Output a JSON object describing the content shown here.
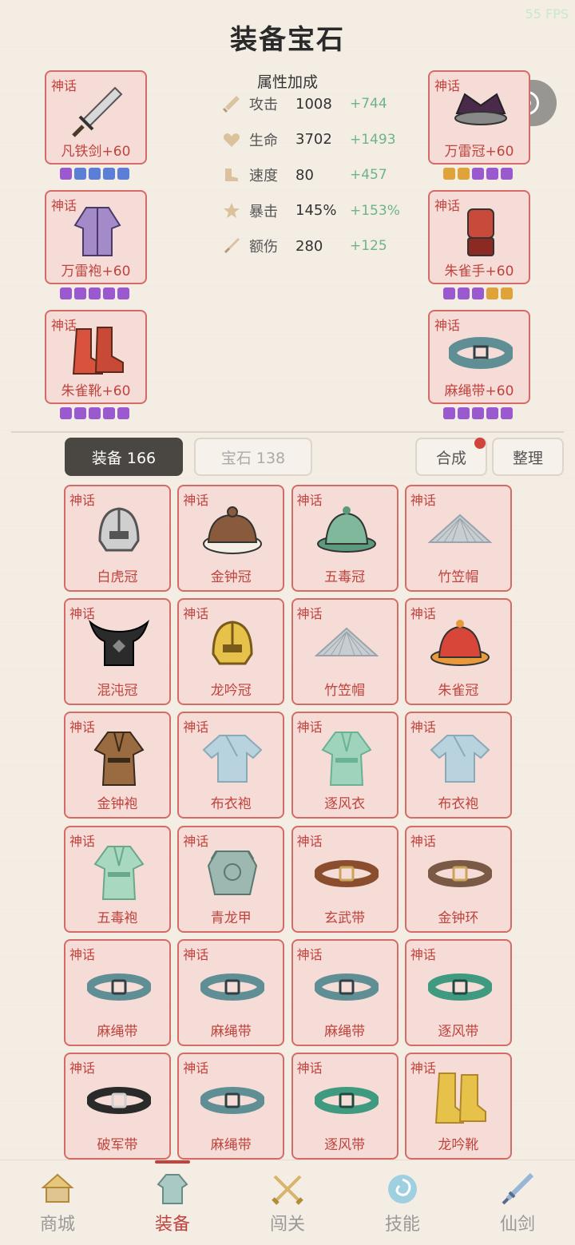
{
  "status": {
    "fps": "55 FPS"
  },
  "title": "装备宝石",
  "capsule": {
    "more_icon": "more-dots-icon",
    "close_icon": "target-icon"
  },
  "equipped": [
    {
      "tier": "神话",
      "name": "凡铁剑+60",
      "icon": "sword-icon",
      "gems": [
        "#9b59d0",
        "#5b7fd6",
        "#5b7fd6",
        "#5b7fd6",
        "#5b7fd6"
      ]
    },
    {
      "tier": "神话",
      "name": "万雷冠+60",
      "icon": "crown-icon",
      "gems": [
        "#e0a33a",
        "#e0a33a",
        "#9b59d0",
        "#9b59d0",
        "#9b59d0"
      ]
    },
    {
      "tier": "神话",
      "name": "万雷袍+60",
      "icon": "robe-icon",
      "gems": [
        "#9b59d0",
        "#9b59d0",
        "#9b59d0",
        "#9b59d0",
        "#9b59d0"
      ]
    },
    {
      "tier": "神话",
      "name": "朱雀手+60",
      "icon": "glove-icon",
      "gems": [
        "#9b59d0",
        "#9b59d0",
        "#9b59d0",
        "#e0a33a",
        "#e0a33a"
      ]
    },
    {
      "tier": "神话",
      "name": "朱雀靴+60",
      "icon": "boots-icon",
      "gems": [
        "#9b59d0",
        "#9b59d0",
        "#9b59d0",
        "#9b59d0",
        "#9b59d0"
      ]
    },
    {
      "tier": "神话",
      "name": "麻绳带+60",
      "icon": "belt-icon",
      "gems": [
        "#9b59d0",
        "#9b59d0",
        "#9b59d0",
        "#9b59d0",
        "#9b59d0"
      ]
    }
  ],
  "attributes": {
    "heading": "属性加成",
    "rows": [
      {
        "icon": "sword-attr-icon",
        "label": "攻击",
        "value": "1008",
        "bonus": "+744"
      },
      {
        "icon": "heart-icon",
        "label": "生命",
        "value": "3702",
        "bonus": "+1493"
      },
      {
        "icon": "boot-attr-icon",
        "label": "速度",
        "value": "80",
        "bonus": "+457"
      },
      {
        "icon": "star-icon",
        "label": "暴击",
        "value": "145%",
        "bonus": "+153%"
      },
      {
        "icon": "dagger-attr-icon",
        "label": "额伤",
        "value": "280",
        "bonus": "+125"
      }
    ]
  },
  "tabs": {
    "equip": "装备 166",
    "gem": "宝石 138",
    "synth": "合成",
    "sort": "整理"
  },
  "inventory": [
    {
      "tier": "神话",
      "name": "白虎冠",
      "kind": "helmet",
      "color": "#cfcfcf",
      "accent": "#555555"
    },
    {
      "tier": "神话",
      "name": "金钟冠",
      "kind": "cap",
      "color": "#8a5a3c",
      "accent": "#f4eee4"
    },
    {
      "tier": "神话",
      "name": "五毒冠",
      "kind": "bell-hat",
      "color": "#7fb89b",
      "accent": "#5b9a7c"
    },
    {
      "tier": "神话",
      "name": "竹笠帽",
      "kind": "straw-hat",
      "color": "#c8cdd2",
      "accent": "#9aa3ab"
    },
    {
      "tier": "神话",
      "name": "混沌冠",
      "kind": "horn-helmet",
      "color": "#2b2b2b",
      "accent": "#888888"
    },
    {
      "tier": "神话",
      "name": "龙吟冠",
      "kind": "helmet",
      "color": "#e7c24a",
      "accent": "#7a5a1a"
    },
    {
      "tier": "神话",
      "name": "竹笠帽",
      "kind": "straw-hat",
      "color": "#c8cdd2",
      "accent": "#9aa3ab"
    },
    {
      "tier": "神话",
      "name": "朱雀冠",
      "kind": "bell-hat",
      "color": "#d8463a",
      "accent": "#e89a3a"
    },
    {
      "tier": "神话",
      "name": "金钟袍",
      "kind": "robe",
      "color": "#9a6a40",
      "accent": "#3a2a1a"
    },
    {
      "tier": "神话",
      "name": "布衣袍",
      "kind": "shirt",
      "color": "#b9d3de",
      "accent": "#8aaab8"
    },
    {
      "tier": "神话",
      "name": "逐风衣",
      "kind": "robe",
      "color": "#9fd3bc",
      "accent": "#6ab294"
    },
    {
      "tier": "神话",
      "name": "布衣袍",
      "kind": "shirt",
      "color": "#b9d3de",
      "accent": "#8aaab8"
    },
    {
      "tier": "神话",
      "name": "五毒袍",
      "kind": "robe",
      "color": "#a8d8bf",
      "accent": "#6aa88a"
    },
    {
      "tier": "神话",
      "name": "青龙甲",
      "kind": "armor",
      "color": "#9cb8b0",
      "accent": "#5a7870"
    },
    {
      "tier": "神话",
      "name": "玄武带",
      "kind": "belt",
      "color": "#8a4e2e",
      "accent": "#c9a45a"
    },
    {
      "tier": "神话",
      "name": "金钟环",
      "kind": "belt",
      "color": "#7a5a44",
      "accent": "#c9a45a"
    },
    {
      "tier": "神话",
      "name": "麻绳带",
      "kind": "belt",
      "color": "#5f8f95",
      "accent": "#2f3f44"
    },
    {
      "tier": "神话",
      "name": "麻绳带",
      "kind": "belt",
      "color": "#5f8f95",
      "accent": "#2f3f44"
    },
    {
      "tier": "神话",
      "name": "麻绳带",
      "kind": "belt",
      "color": "#5f8f95",
      "accent": "#2f3f44"
    },
    {
      "tier": "神话",
      "name": "逐风带",
      "kind": "belt",
      "color": "#3f9a80",
      "accent": "#1f4a3f"
    },
    {
      "tier": "神话",
      "name": "破军带",
      "kind": "belt",
      "color": "#2a2a2a",
      "accent": "#cfcfcf"
    },
    {
      "tier": "神话",
      "name": "麻绳带",
      "kind": "belt",
      "color": "#5f8f95",
      "accent": "#2f3f44"
    },
    {
      "tier": "神话",
      "name": "逐风带",
      "kind": "belt",
      "color": "#3f9a80",
      "accent": "#1f4a3f"
    },
    {
      "tier": "神话",
      "name": "龙吟靴",
      "kind": "tall-boots",
      "color": "#e7c24a",
      "accent": "#b3862a"
    }
  ],
  "nav": [
    {
      "label": "商城",
      "icon": "shop-icon",
      "active": false
    },
    {
      "label": "装备",
      "icon": "equipment-icon",
      "active": true
    },
    {
      "label": "闯关",
      "icon": "crossed-swords-icon",
      "active": false
    },
    {
      "label": "技能",
      "icon": "swirl-icon",
      "active": false
    },
    {
      "label": "仙剑",
      "icon": "flying-sword-icon",
      "active": false
    }
  ],
  "colors": {
    "tier_red": "#c0433e",
    "card_bg": "#f5dcd7",
    "card_border": "#d56b66",
    "bonus_green": "#6eb48a"
  }
}
